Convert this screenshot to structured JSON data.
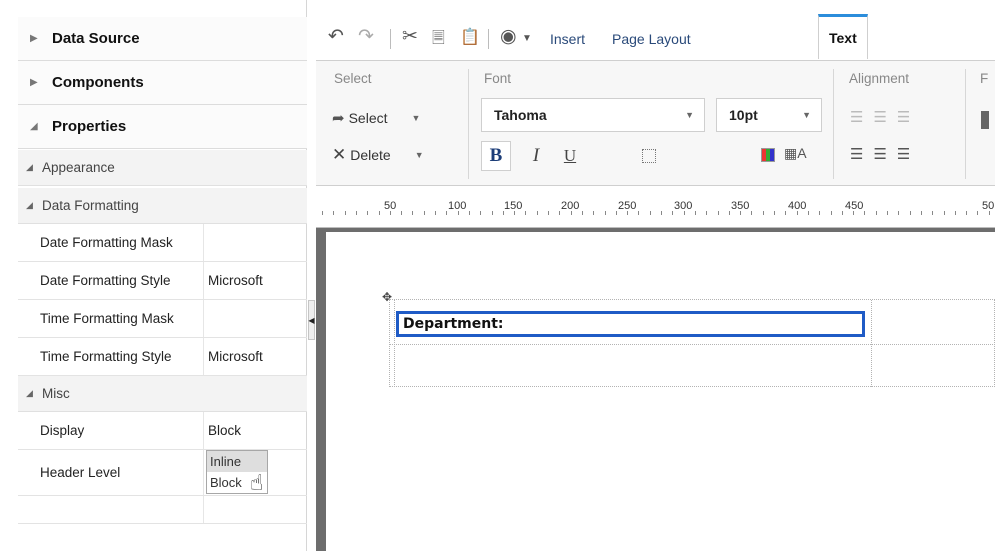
{
  "left_panel": {
    "accordions": [
      {
        "label": "Data Source",
        "expanded": false
      },
      {
        "label": "Components",
        "expanded": false
      },
      {
        "label": "Properties",
        "expanded": true
      }
    ],
    "groups": {
      "appearance": "Appearance",
      "data_formatting": "Data Formatting",
      "misc": "Misc"
    },
    "rows": [
      {
        "name": "Date Formatting Mask",
        "value": ""
      },
      {
        "name": "Date Formatting Style",
        "value": "Microsoft"
      },
      {
        "name": "Time Formatting Mask",
        "value": ""
      },
      {
        "name": "Time Formatting Style",
        "value": "Microsoft"
      },
      {
        "name": "Display",
        "value": "Block"
      },
      {
        "name": "Header Level",
        "value": ""
      }
    ],
    "header_level_options": [
      "Inline",
      "Block"
    ],
    "header_level_highlighted": "Inline"
  },
  "toolbar": {
    "tabs": [
      "Insert",
      "Page Layout",
      "Text"
    ],
    "active_tab": "Text",
    "icons": [
      "undo-icon",
      "redo-icon",
      "cut-icon",
      "copy-icon",
      "paste-icon",
      "preview-icon"
    ]
  },
  "ribbon": {
    "select_section": {
      "title": "Select",
      "select_label": "Select",
      "delete_label": "Delete"
    },
    "font_section": {
      "title": "Font",
      "font_name": "Tahoma",
      "font_size": "10pt",
      "bold": "B",
      "italic": "I",
      "underline": "U"
    },
    "alignment_section": {
      "title": "Alignment"
    },
    "cut_section_letter": "F"
  },
  "ruler": {
    "labels": [
      "50",
      "100",
      "150",
      "200",
      "250",
      "300",
      "350",
      "400",
      "450",
      "50"
    ]
  },
  "canvas": {
    "department_label": "Department:"
  },
  "colors": {
    "accent": "#2b8ddb",
    "selection_border": "#1f5bc6",
    "canvas_bg": "#6d6d6d"
  }
}
